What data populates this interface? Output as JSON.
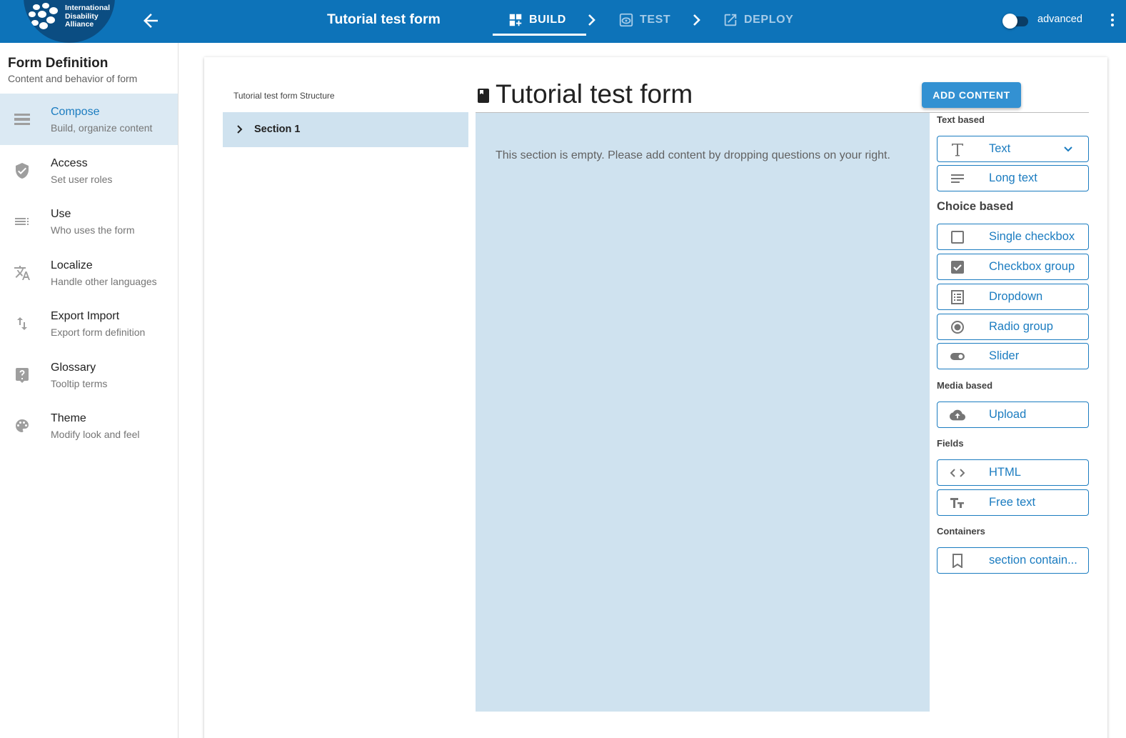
{
  "header": {
    "logo_text": [
      "International",
      "Disability",
      "Alliance"
    ],
    "title": "Tutorial test form",
    "steps": [
      {
        "label": "BUILD",
        "icon": "dashboard-add-icon"
      },
      {
        "label": "TEST",
        "icon": "preview-eye-icon"
      },
      {
        "label": "DEPLOY",
        "icon": "open-in-new-icon"
      }
    ],
    "advanced_label": "advanced",
    "advanced_on": false
  },
  "sidebar": {
    "title": "Form Definition",
    "subtitle": "Content and behavior of form",
    "items": [
      {
        "label": "Compose",
        "sub": "Build, organize content",
        "icon": "compose-icon",
        "active": true
      },
      {
        "label": "Access",
        "sub": "Set user roles",
        "icon": "shield-check-icon"
      },
      {
        "label": "Use",
        "sub": "Who uses the form",
        "icon": "list-icon"
      },
      {
        "label": "Localize",
        "sub": "Handle other languages",
        "icon": "translate-icon"
      },
      {
        "label": "Export Import",
        "sub": "Export form definition",
        "icon": "import-export-icon"
      },
      {
        "label": "Glossary",
        "sub": "Tooltip terms",
        "icon": "help-box-icon"
      },
      {
        "label": "Theme",
        "sub": "Modify look and feel",
        "icon": "palette-icon"
      }
    ]
  },
  "structure": {
    "title": "Tutorial test form Structure",
    "sections": [
      {
        "label": "Section 1"
      }
    ]
  },
  "form": {
    "heading": "Tutorial test form",
    "empty_message": "This section is empty. Please add content by dropping questions on your right.",
    "add_content_label": "ADD CONTENT"
  },
  "palette": {
    "text_based": "Text based",
    "choice_based": "Choice based",
    "media_based": "Media based",
    "fields": "Fields",
    "containers": "Containers",
    "text": "Text",
    "long_text": "Long text",
    "single_checkbox": "Single checkbox",
    "checkbox_group": "Checkbox group",
    "dropdown": "Dropdown",
    "radio_group": "Radio group",
    "slider": "Slider",
    "upload": "Upload",
    "html": "HTML",
    "free_text": "Free text",
    "section_container": "section contain..."
  },
  "colors": {
    "topbar": "#0d73b9",
    "accent": "#1b7cc0",
    "selected_bg": "#cfe2ef",
    "add_button": "#3391d2"
  }
}
